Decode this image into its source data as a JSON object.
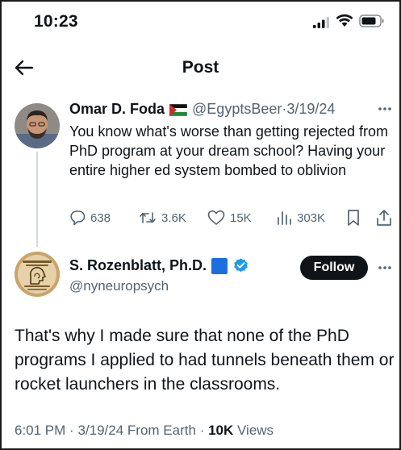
{
  "status_bar": {
    "time": "10:23"
  },
  "header": {
    "title": "Post"
  },
  "quoted_tweet": {
    "author_name": "Omar D. Foda",
    "handle": "@EgyptsBeer",
    "separator": "·",
    "date": "3/19/24",
    "text": "You know what's worse than getting rejected from PhD program at your dream school? Having your entire higher ed system bombed to oblivion",
    "replies": "638",
    "reposts": "3.6K",
    "likes": "15K",
    "views": "303K"
  },
  "main_tweet": {
    "author_name": "S. Rozenblatt, Ph.D.",
    "handle": "@nyneuropsych",
    "follow_label": "Follow",
    "text": "That's why I made sure that none of the PhD programs I applied to had tunnels beneath them or rocket launchers in the classrooms.",
    "time": "6:01 PM",
    "date": "3/19/24",
    "source": "From Earth",
    "views_count": "10K",
    "views_label": "Views"
  },
  "colors": {
    "text": "#0f1419",
    "secondary": "#536471",
    "verified": "#1d9bf0",
    "flag_square": "#1d6fe0"
  },
  "icons": [
    "back-arrow-icon",
    "more-icon",
    "reply-icon",
    "repost-icon",
    "like-icon",
    "views-icon",
    "bookmark-icon",
    "share-icon",
    "verified-badge-icon",
    "palestine-flag-icon"
  ]
}
